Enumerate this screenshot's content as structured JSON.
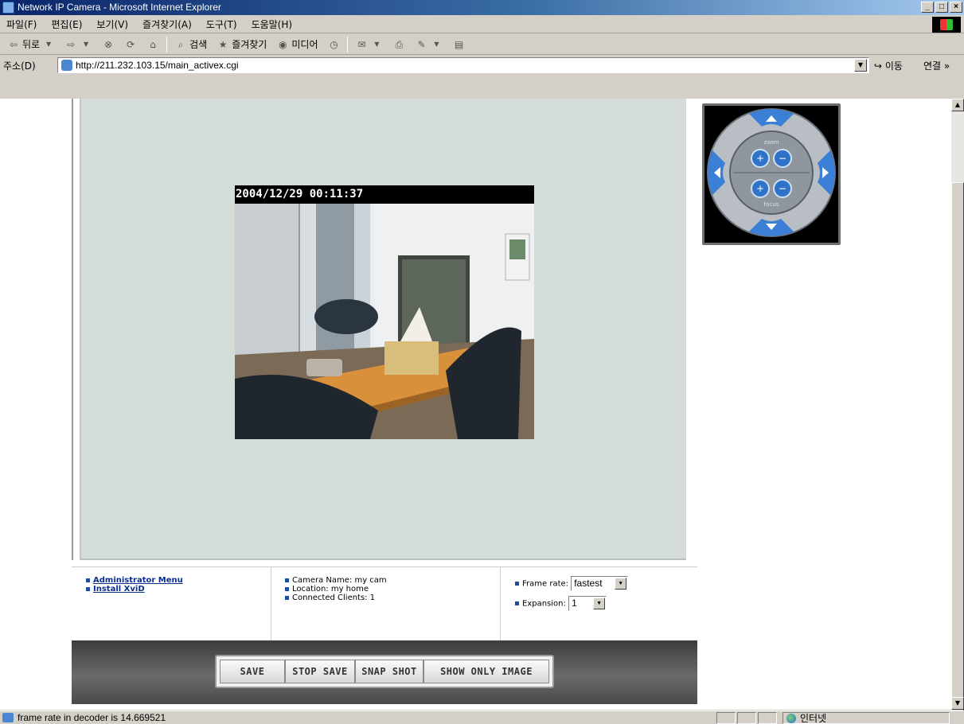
{
  "window": {
    "title": "Network IP Camera - Microsoft Internet Explorer",
    "controls": [
      "_",
      "□",
      "×"
    ]
  },
  "menu": [
    "파일(F)",
    "편집(E)",
    "보기(V)",
    "즐겨찾기(A)",
    "도구(T)",
    "도움말(H)"
  ],
  "toolbar": {
    "back_label": "뒤로",
    "search_label": "검색",
    "favorites_label": "즐겨찾기",
    "media_label": "미디어"
  },
  "address": {
    "label": "주소(D)",
    "url": "http://211.232.103.15/main_activex.cgi",
    "go_label": "이동",
    "links_label": "연결 »"
  },
  "video": {
    "timestamp": "2004/12/29 00:11:37"
  },
  "ptz": {
    "zoom_label": "zoom",
    "focus_label": "focus"
  },
  "info": {
    "links": [
      "Administrator Menu",
      "Install XviD"
    ],
    "camera_name": "Camera Name: my cam",
    "location": "Location: my home",
    "connected_clients": "Connected Clients: 1",
    "frame_rate_label": "Frame rate:",
    "frame_rate_value": "fastest",
    "expansion_label": "Expansion:",
    "expansion_value": "1"
  },
  "buttons": [
    "SAVE",
    "STOP SAVE",
    "SNAP SHOT",
    "SHOW ONLY IMAGE"
  ],
  "status": {
    "text": "frame rate in decoder is 14.669521",
    "zone": "인터넷"
  }
}
